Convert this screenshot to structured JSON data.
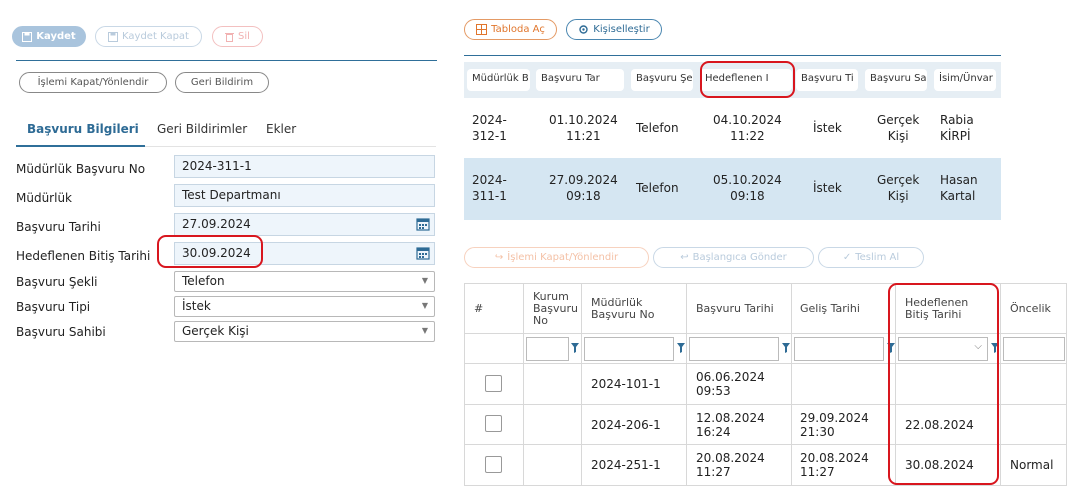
{
  "toolbar": {
    "save": "Kaydet",
    "save_close": "Kaydet Kapat",
    "delete": "Sil",
    "close_direct": "İşlemi Kapat/Yönlendir",
    "feedback": "Geri Bildirim"
  },
  "tabs": [
    "Başvuru Bilgileri",
    "Geri Bildirimler",
    "Ekler"
  ],
  "form": {
    "no_label": "Müdürlük Başvuru No",
    "no_value": "2024-311-1",
    "dept_label": "Müdürlük",
    "dept_value": "Test Departmanı",
    "date_label": "Başvuru Tarihi",
    "date_value": "27.09.2024",
    "target_label": "Hedeflenen Bitiş Tarihi",
    "target_value": "30.09.2024",
    "method_label": "Başvuru Şekli",
    "method_value": "Telefon",
    "type_label": "Başvuru Tipi",
    "type_value": "İstek",
    "owner_label": "Başvuru Sahibi",
    "owner_value": "Gerçek Kişi"
  },
  "top_buttons": {
    "open_table": "Tabloda Aç",
    "customize": "Kişiselleştir"
  },
  "grid1": {
    "headers": [
      "Müdürlük B",
      "Başvuru Tar",
      "Başvuru Şe",
      "Hedeflenen I",
      "Başvuru Ti",
      "Başvuru Sa",
      "İsim/Ünvar"
    ],
    "rows": [
      {
        "no_a": "2024-",
        "no_b": "312-1",
        "date_a": "01.10.2024",
        "date_b": "11:21",
        "method": "Telefon",
        "target_a": "04.10.2024",
        "target_b": "11:22",
        "type": "İstek",
        "owner_a": "Gerçek",
        "owner_b": "Kişi",
        "name_a": "Rabia",
        "name_b": "KİRPİ"
      },
      {
        "no_a": "2024-",
        "no_b": "311-1",
        "date_a": "27.09.2024",
        "date_b": "09:18",
        "method": "Telefon",
        "target_a": "05.10.2024",
        "target_b": "09:18",
        "type": "İstek",
        "owner_a": "Gerçek",
        "owner_b": "Kişi",
        "name_a": "Hasan",
        "name_b": "Kartal"
      }
    ]
  },
  "lower_toolbar": {
    "close_direct": "İşlemi Kapat/Yönlendir",
    "send_start": "Başlangıca Gönder",
    "receive": "Teslim Al"
  },
  "grid2": {
    "headers": {
      "hash": "#",
      "kurum_a": "Kurum",
      "kurum_b": "Başvuru",
      "kurum_c": "No",
      "mud_a": "Müdürlük",
      "mud_b": "Başvuru No",
      "date": "Başvuru Tarihi",
      "arrival": "Geliş Tarihi",
      "target_a": "Hedeflenen",
      "target_b": "Bitiş Tarihi",
      "priority": "Öncelik"
    },
    "rows": [
      {
        "no": "2024-101-1",
        "date_a": "06.06.2024",
        "date_b": "09:53",
        "arr_a": "",
        "arr_b": "",
        "target": "",
        "priority": ""
      },
      {
        "no": "2024-206-1",
        "date_a": "12.08.2024",
        "date_b": "16:24",
        "arr_a": "29.09.2024",
        "arr_b": "21:30",
        "target": "22.08.2024",
        "priority": ""
      },
      {
        "no": "2024-251-1",
        "date_a": "20.08.2024",
        "date_b": "11:27",
        "arr_a": "20.08.2024",
        "arr_b": "11:27",
        "target": "30.08.2024",
        "priority": "Normal"
      }
    ]
  }
}
